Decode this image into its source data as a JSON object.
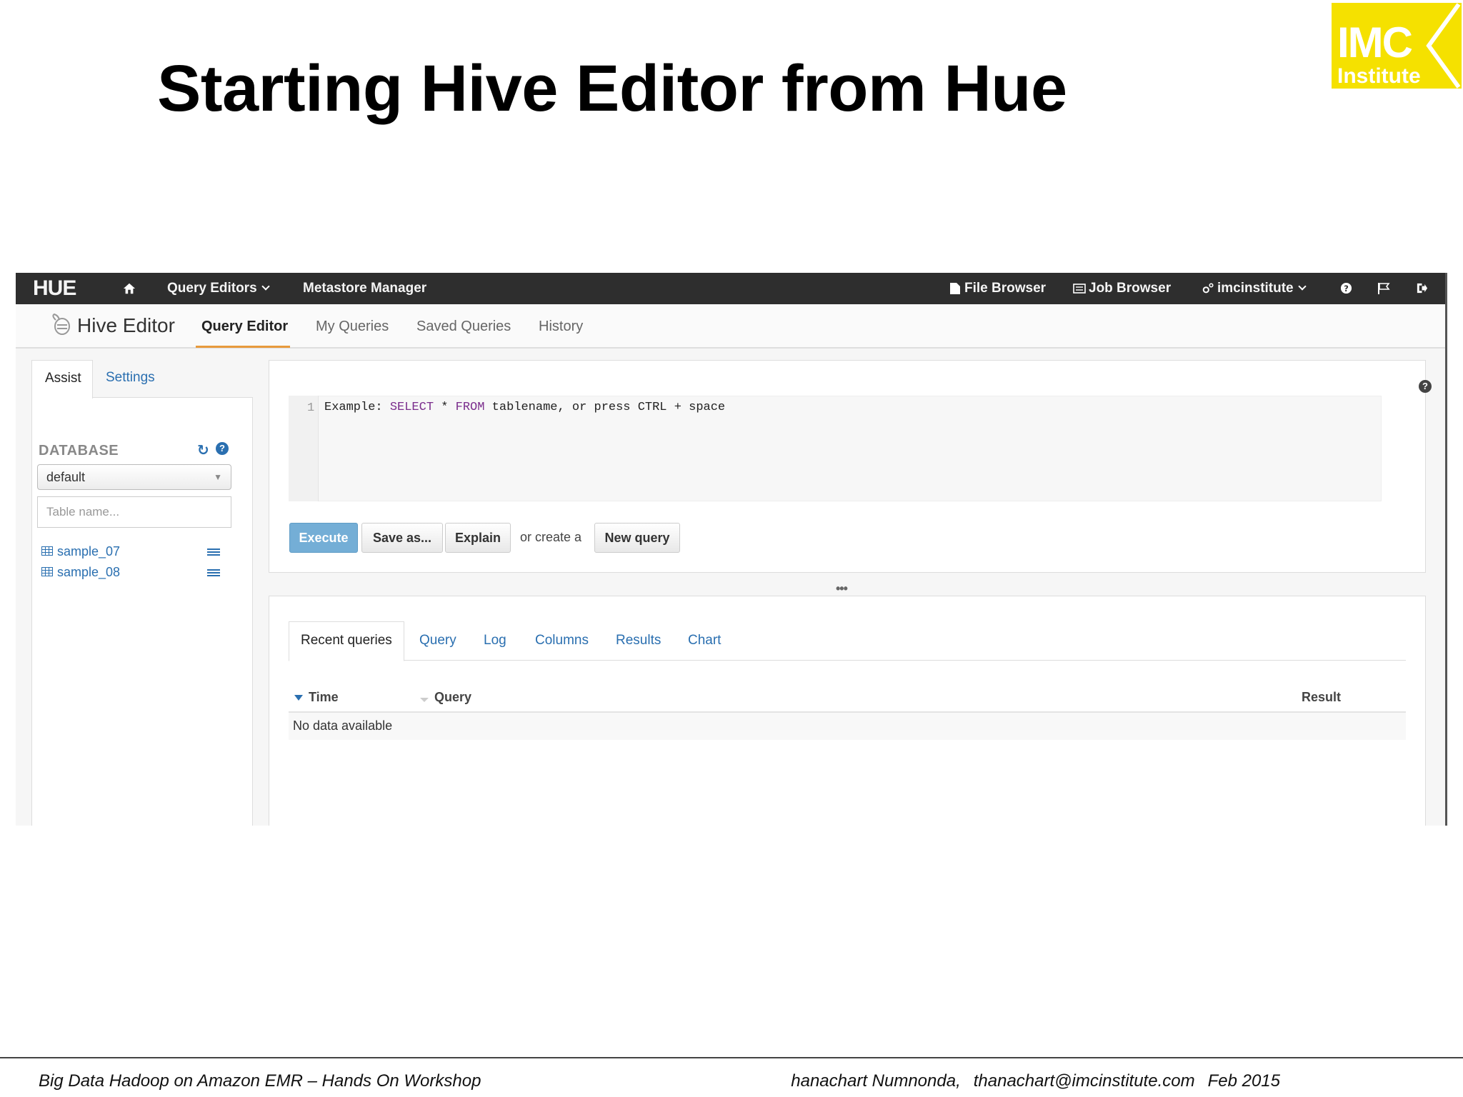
{
  "slide": {
    "title": "Starting Hive Editor from Hue",
    "logo": {
      "top": "IMC",
      "bottom": "Institute"
    },
    "footer_left": "Big Data Hadoop on Amazon EMR – Hands On Workshop",
    "footer_right": [
      "hanachart Numnonda,",
      "thanachart@imcinstitute.com",
      "Feb 2015"
    ]
  },
  "hue": {
    "navbar": {
      "logo": "HUE",
      "query_editors": "Query Editors",
      "metastore_manager": "Metastore Manager",
      "file_browser": "File Browser",
      "job_browser": "Job Browser",
      "user": "imcinstitute"
    },
    "appbar": {
      "app_name": "Hive Editor",
      "tabs": [
        "Query Editor",
        "My Queries",
        "Saved Queries",
        "History"
      ]
    },
    "assist": {
      "tabs": [
        "Assist",
        "Settings"
      ],
      "database_label": "DATABASE",
      "database_value": "default",
      "table_placeholder": "Table name...",
      "tables": [
        "sample_07",
        "sample_08"
      ]
    },
    "editor": {
      "line_number": "1",
      "code_prefix": "Example: ",
      "code_kw1": "SELECT",
      "code_mid": " * ",
      "code_kw2": "FROM",
      "code_suffix": " tablename, or press CTRL + space",
      "execute": "Execute",
      "save_as": "Save as...",
      "explain": "Explain",
      "or_create": "or create a",
      "new_query": "New query"
    },
    "results": {
      "tabs": [
        "Recent queries",
        "Query",
        "Log",
        "Columns",
        "Results",
        "Chart"
      ],
      "columns": [
        "Time",
        "Query",
        "Result"
      ],
      "empty": "No data available"
    }
  },
  "colors": {
    "navbar_bg": "#2e2e2e",
    "link_blue": "#2a6fb0",
    "execute_blue": "#74aed6",
    "tab_underline_orange": "#e89a3c",
    "logo_yellow": "#f5e100"
  }
}
